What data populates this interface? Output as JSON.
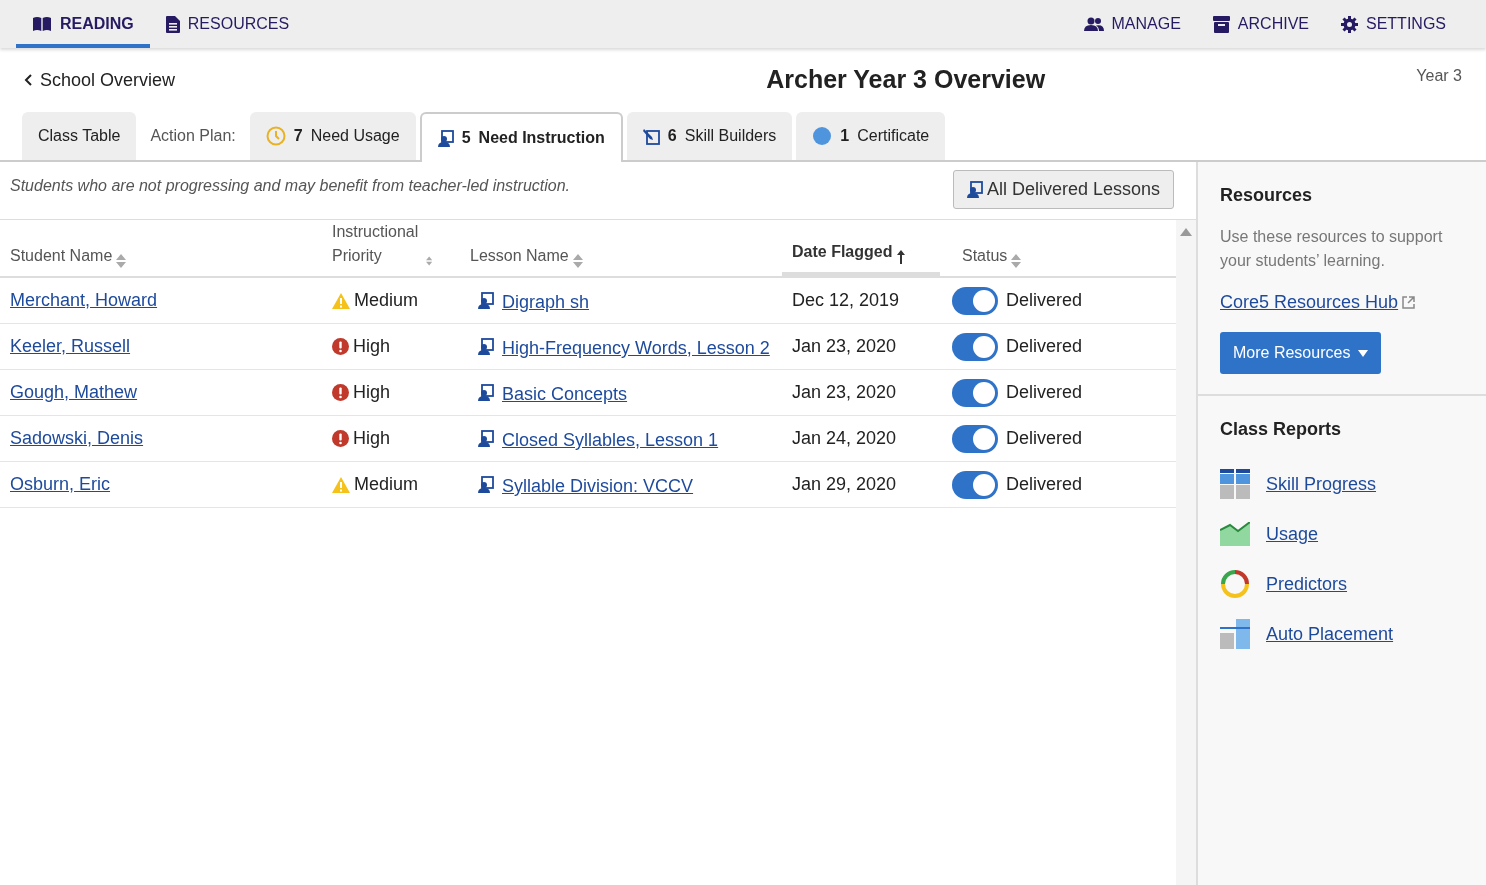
{
  "top_nav": {
    "left": [
      {
        "label": "READING",
        "selected": true
      },
      {
        "label": "RESOURCES",
        "selected": false
      }
    ],
    "right": [
      {
        "label": "MANAGE"
      },
      {
        "label": "ARCHIVE"
      },
      {
        "label": "SETTINGS"
      }
    ]
  },
  "back_link": "School Overview",
  "title": "Archer Year 3 Overview",
  "grade": "Year 3",
  "tabs": {
    "first": {
      "label": "Class Table",
      "selected": false
    },
    "action_plan_label": "Action Plan:",
    "items": [
      {
        "count": "7",
        "label": "Need Usage",
        "selected": false
      },
      {
        "count": "5",
        "label": "Need Instruction",
        "selected": true
      },
      {
        "count": "6",
        "label": "Skill Builders",
        "selected": false
      },
      {
        "count": "1",
        "label": "Certificate",
        "selected": false
      }
    ]
  },
  "description": "Students who are not progressing and may benefit from teacher-led instruction.",
  "all_delivered_button": "All Delivered Lessons",
  "table": {
    "columns": [
      {
        "label": "Student Name",
        "sorted": false
      },
      {
        "label": "Instructional Priority",
        "sorted": false
      },
      {
        "label": "Lesson Name",
        "sorted": false
      },
      {
        "label": "Date Flagged",
        "sorted": true
      },
      {
        "label": "Status",
        "sorted": false
      }
    ],
    "rows": [
      {
        "student": "Merchant, Howard",
        "priority": "Medium",
        "kind": "medium",
        "lesson": "Digraph sh",
        "date": "Dec 12, 2019",
        "delivered": true,
        "status": "Delivered"
      },
      {
        "student": "Keeler, Russell",
        "priority": "High",
        "kind": "high",
        "lesson": "High-Frequency Words, Lesson 2",
        "date": "Jan 23, 2020",
        "delivered": true,
        "status": "Delivered"
      },
      {
        "student": "Gough, Mathew",
        "priority": "High",
        "kind": "high",
        "lesson": "Basic Concepts",
        "date": "Jan 23, 2020",
        "delivered": true,
        "status": "Delivered"
      },
      {
        "student": "Sadowski, Denis",
        "priority": "High",
        "kind": "high",
        "lesson": "Closed Syllables, Lesson 1",
        "date": "Jan 24, 2020",
        "delivered": true,
        "status": "Delivered"
      },
      {
        "student": "Osburn, Eric",
        "priority": "Medium",
        "kind": "medium",
        "lesson": "Syllable Division: VCCV",
        "date": "Jan 29, 2020",
        "delivered": true,
        "status": "Delivered"
      }
    ]
  },
  "sidebar": {
    "resources": {
      "heading": "Resources",
      "text": "Use these resources to support your students’ learning.",
      "link": "Core5 Resources Hub",
      "button": "More Resources"
    },
    "class_reports": {
      "heading": "Class Reports",
      "items": [
        {
          "label": "Skill Progress",
          "kind": "skill"
        },
        {
          "label": "Usage",
          "kind": "usage"
        },
        {
          "label": "Predictors",
          "kind": "predictors"
        },
        {
          "label": "Auto Placement",
          "kind": "placement"
        }
      ]
    }
  }
}
